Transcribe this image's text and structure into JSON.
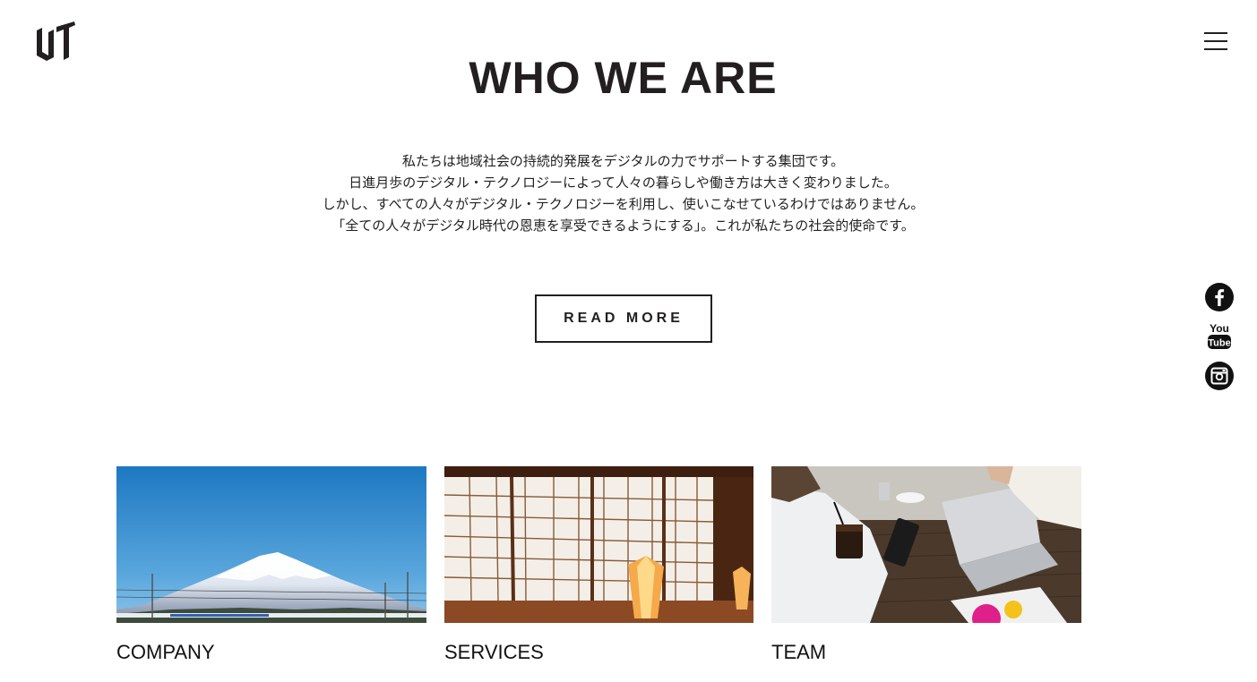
{
  "header": {
    "logo_icon": "uti-logo-icon",
    "menu_icon": "hamburger-menu-icon"
  },
  "section": {
    "title": "WHO WE ARE",
    "paragraph": [
      "私たちは地域社会の持続的発展をデジタルの力でサポートする集団です。",
      "日進月歩のデジタル・テクノロジーによって人々の暮らしや働き方は大きく変わりました。",
      "しかし、すべての人々がデジタル・テクノロジーを利用し、使いこなせているわけではありません。",
      "「全ての人々がデジタル時代の恩恵を享受できるようにする」。これが私たちの社会的使命です。"
    ],
    "read_more_label": "READ MORE"
  },
  "social": [
    {
      "icon": "facebook-icon"
    },
    {
      "icon": "youtube-icon"
    },
    {
      "icon": "instagram-icon"
    }
  ],
  "cards": [
    {
      "label": "COMPANY",
      "image": "mount-fuji-bullet-train-image"
    },
    {
      "label": "SERVICES",
      "image": "japanese-shoji-room-image"
    },
    {
      "label": "TEAM",
      "image": "cafe-meeting-devices-image"
    }
  ],
  "colors": {
    "text": "#231f20",
    "background": "#ffffff",
    "accent": "#000000"
  }
}
